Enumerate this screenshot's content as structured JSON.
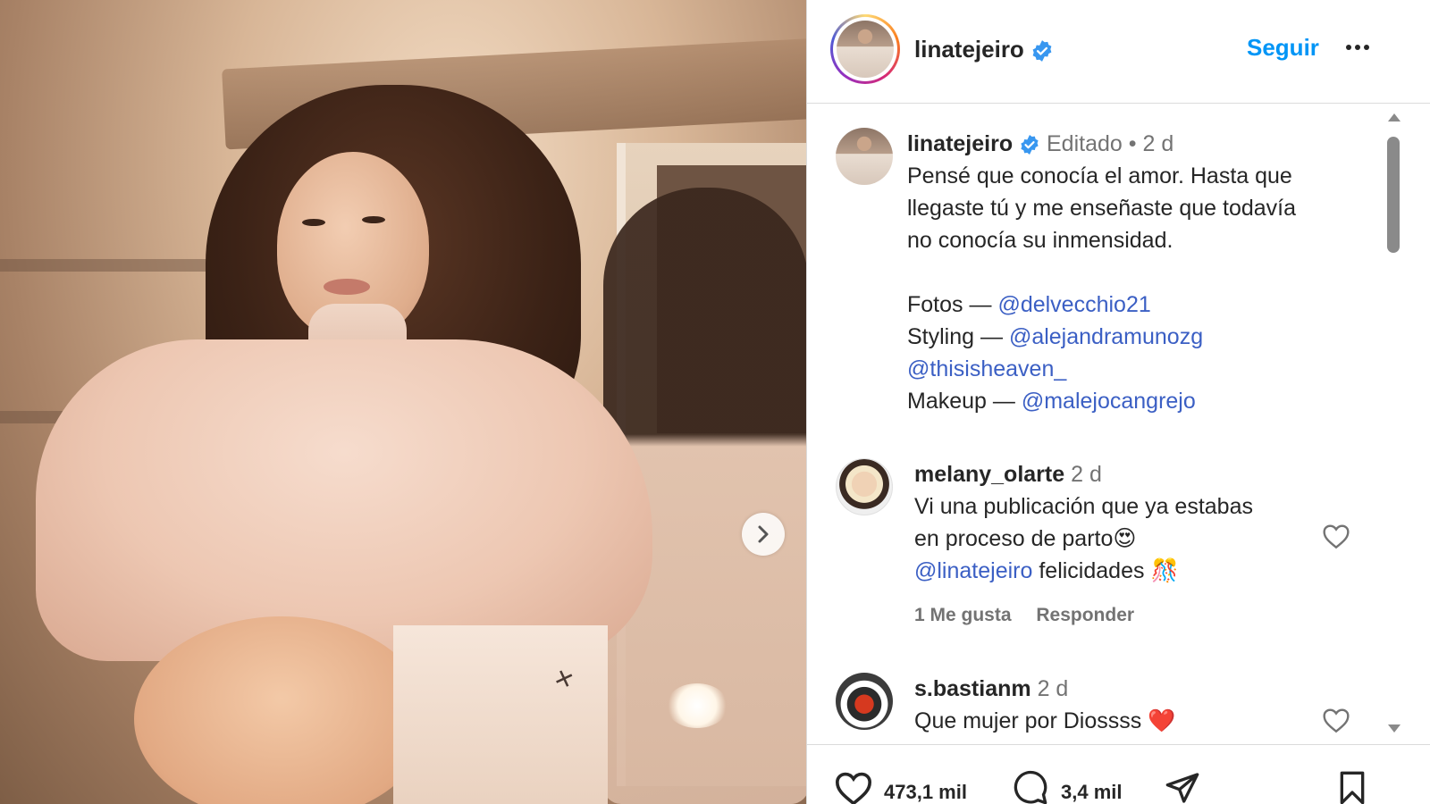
{
  "post": {
    "photo_alt": "Photo carousel image",
    "next_icon": "chevron-right-icon"
  },
  "header": {
    "username": "linatejeiro",
    "follow_label": "Seguir",
    "more_icon": "more-horizontal-icon",
    "verified_color": "#3897f0"
  },
  "caption": {
    "username": "linatejeiro",
    "edited": "Editado",
    "separator": "•",
    "time": "2 d",
    "line1": "Pensé que conocía el amor. Hasta que",
    "line2": "llegaste tú y me enseñaste que todavía",
    "line3": "no conocía su inmensidad.",
    "credits": [
      {
        "label": "Fotos —",
        "mention": "@delvecchio21"
      },
      {
        "label": "Styling —",
        "mention": "@alejandramunozg"
      },
      {
        "label": "",
        "mention": "@thisisheaven_"
      },
      {
        "label": "Makeup —",
        "mention": "@malejocangrejo"
      }
    ]
  },
  "comments": [
    {
      "username": "melany_olarte",
      "time": "2 d",
      "line1": "Vi una publicación que ya estabas",
      "line2_text": "en proceso de parto",
      "line2_emoji": "😍",
      "line3_mention": "@linatejeiro",
      "line3_text": "felicidades",
      "line3_emoji": "🎊",
      "likes": "1 Me gusta",
      "reply": "Responder"
    },
    {
      "username": "s.bastianm",
      "time": "2 d",
      "text": "Que mujer por Diossss",
      "emoji": "❤️"
    }
  ],
  "footer": {
    "likes_count": "473,1 mil",
    "comments_count": "3,4 mil"
  },
  "colors": {
    "accent": "#0095f6",
    "mention": "#3b5fc4",
    "muted": "#737373",
    "heart_emoji": "#e8315b"
  }
}
